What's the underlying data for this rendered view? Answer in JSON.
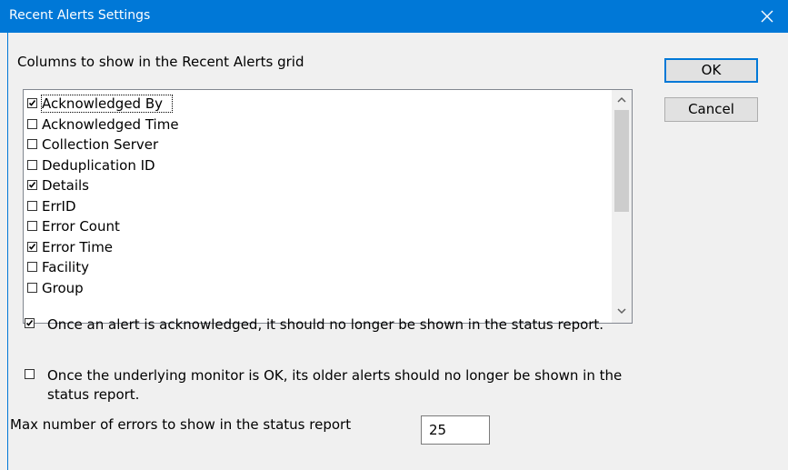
{
  "window": {
    "title": "Recent Alerts Settings"
  },
  "columns_label": "Columns to show in the Recent Alerts grid",
  "buttons": {
    "ok": "OK",
    "cancel": "Cancel"
  },
  "columns": [
    {
      "label": "Acknowledged By",
      "checked": true
    },
    {
      "label": "Acknowledged Time",
      "checked": false
    },
    {
      "label": "Collection Server",
      "checked": false
    },
    {
      "label": "Deduplication ID",
      "checked": false
    },
    {
      "label": "Details",
      "checked": true
    },
    {
      "label": "ErrID",
      "checked": false
    },
    {
      "label": "Error Count",
      "checked": false
    },
    {
      "label": "Error Time",
      "checked": true
    },
    {
      "label": "Facility",
      "checked": false
    },
    {
      "label": "Group",
      "checked": false
    }
  ],
  "options": {
    "hide_acknowledged": {
      "label": "Once an alert is acknowledged, it should no longer be shown in the status report.",
      "checked": true
    },
    "hide_when_ok": {
      "label": "Once the underlying monitor is OK, its older alerts should no longer be shown in the status report.",
      "checked": false
    }
  },
  "max_errors": {
    "label": "Max number of errors to show in the status report",
    "value": "25"
  },
  "colors": {
    "titlebar": "#0078d7",
    "background": "#f0f0f0",
    "button": "#e1e1e1"
  }
}
